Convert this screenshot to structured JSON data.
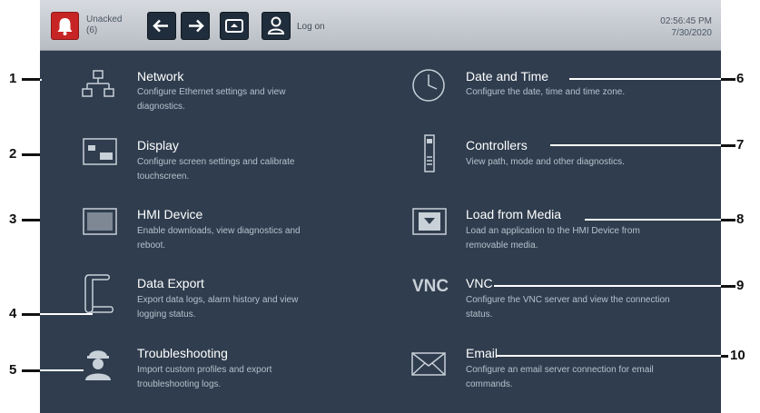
{
  "topbar": {
    "alarm_label_line1": "Unacked",
    "alarm_label_line2": "(6)",
    "logon_label": "Log on",
    "time": "02:56:45 PM",
    "date": "7/30/2020"
  },
  "items": [
    {
      "title": "Network",
      "desc": "Configure Ethernet settings and view diagnostics.",
      "icon": "network-icon"
    },
    {
      "title": "Display",
      "desc": "Configure screen settings and calibrate touchscreen.",
      "icon": "display-icon"
    },
    {
      "title": "HMI Device",
      "desc": "Enable downloads, view diagnostics and reboot.",
      "icon": "hmi-device-icon"
    },
    {
      "title": "Data Export",
      "desc": "Export data logs, alarm history and view logging status.",
      "icon": "scroll-icon"
    },
    {
      "title": "Troubleshooting",
      "desc": "Import custom profiles and export troubleshooting logs.",
      "icon": "worker-helmet-icon"
    },
    {
      "title": "Date and Time",
      "desc": "Configure the date, time and time zone.",
      "icon": "clock-icon"
    },
    {
      "title": "Controllers",
      "desc": "View path, mode and other diagnostics.",
      "icon": "controller-icon"
    },
    {
      "title": "Load from Media",
      "desc": "Load an application to the HMI Device from removable media.",
      "icon": "download-icon"
    },
    {
      "title": "VNC",
      "desc": "Configure the VNC server and view the connection status.",
      "icon": "vnc-icon"
    },
    {
      "title": "Email",
      "desc": "Configure an email server connection for email commands.",
      "icon": "envelope-icon"
    }
  ],
  "vnc_icon_text": "VNC",
  "callouts": [
    "1",
    "2",
    "3",
    "4",
    "5",
    "6",
    "7",
    "8",
    "9",
    "10"
  ]
}
